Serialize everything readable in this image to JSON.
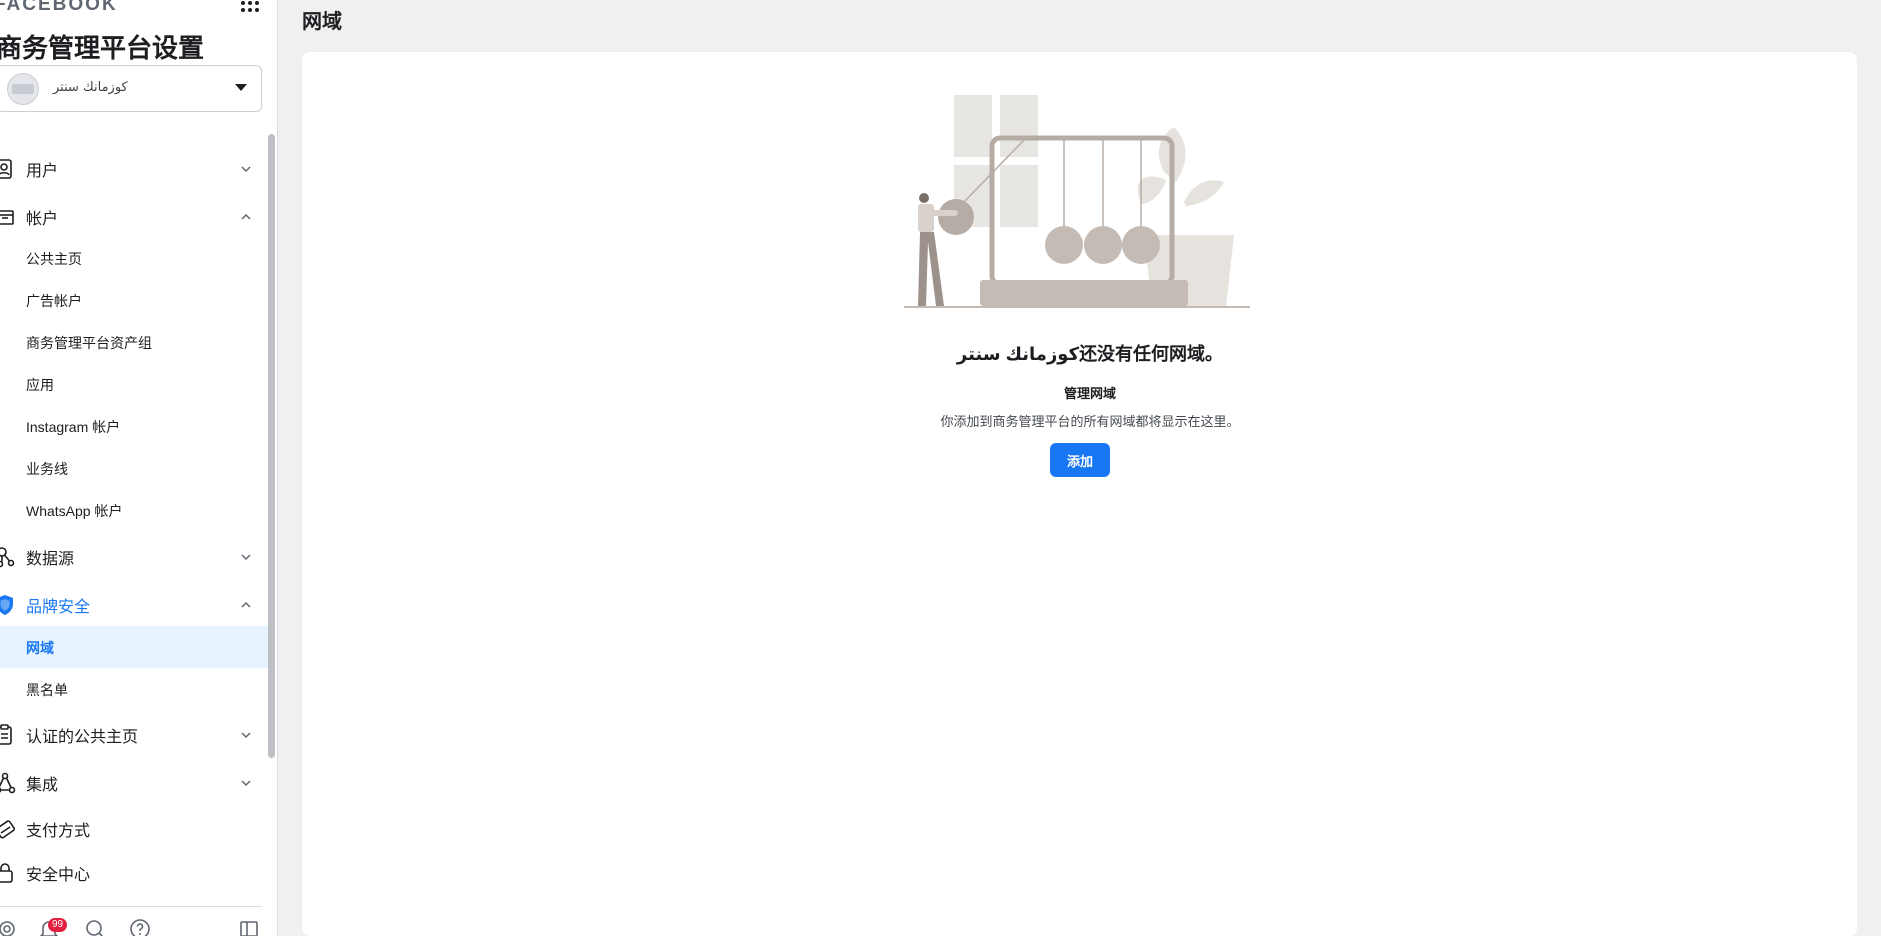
{
  "sidebar": {
    "brand": "FACEBOOK",
    "title": "商务管理平台设置",
    "account": {
      "name": "كوزمانك سنتر"
    },
    "sections": {
      "users": "用户",
      "accounts": "帐户",
      "accounts_items": [
        "公共主页",
        "广告帐户",
        "商务管理平台资产组",
        "应用",
        "Instagram 帐户",
        "业务线",
        "WhatsApp 帐户"
      ],
      "data_sources": "数据源",
      "brand_safety": "品牌安全",
      "brand_safety_items": [
        "网域",
        "黑名单"
      ],
      "verified_pages": "认证的公共主页",
      "integrations": "集成",
      "payment_methods": "支付方式",
      "security_center": "安全中心"
    },
    "notifications_badge": "99"
  },
  "main": {
    "header": "网域",
    "empty_state": {
      "title": "كوزمانك سنتر还没有任何网域。",
      "subtitle": "管理网域",
      "description": "你添加到商务管理平台的所有网域都将显示在这里。",
      "button": "添加"
    }
  },
  "colors": {
    "accent": "#1877f2",
    "active_bg": "#e7f3ff",
    "badge": "#e41e3f"
  }
}
